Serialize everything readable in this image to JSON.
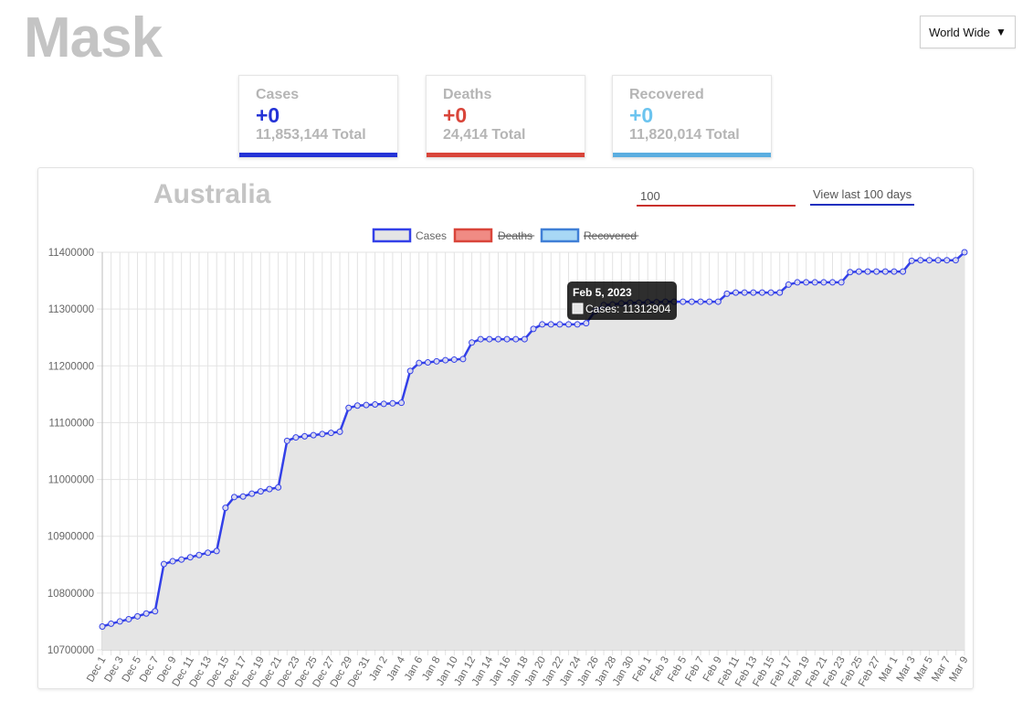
{
  "header": {
    "app_title": "Mask",
    "region_select": {
      "value": "World Wide",
      "arrow": "▼"
    }
  },
  "stats": {
    "cases": {
      "label": "Cases",
      "delta": "+0",
      "total": "11,853,144 Total",
      "color": "#2433d6"
    },
    "deaths": {
      "label": "Deaths",
      "delta": "+0",
      "total": "24,414 Total",
      "color": "#d9453a"
    },
    "recovered": {
      "label": "Recovered",
      "delta": "+0",
      "total": "11,820,014 Total",
      "color": "#6cc4ef"
    }
  },
  "panel": {
    "country": "Australia",
    "days_input_value": "100",
    "view_button": "View last 100 days"
  },
  "colors": {
    "cases_line": "#3340e8",
    "area_fill": "#e5e5e5",
    "deaths_bar": "#d9453a",
    "recovered_bar": "#5aaee0",
    "grid": "#e3e3e3"
  },
  "chart_data": {
    "type": "area",
    "title": "",
    "legend": [
      {
        "name": "Cases",
        "visible": true,
        "border": "#3340e8",
        "fill": "#e5e5e5"
      },
      {
        "name": "Deaths",
        "visible": false,
        "border": "#d9453a",
        "fill": "#f08b84"
      },
      {
        "name": "Recovered",
        "visible": false,
        "border": "#3f7fd6",
        "fill": "#a8d8f5"
      }
    ],
    "legend_position": "top",
    "ylim": [
      10700000,
      11400000
    ],
    "yticks": [
      10700000,
      10800000,
      10900000,
      11000000,
      11100000,
      11200000,
      11300000,
      11400000
    ],
    "x": [
      "Dec 1",
      "Dec 2",
      "Dec 3",
      "Dec 4",
      "Dec 5",
      "Dec 6",
      "Dec 7",
      "Dec 8",
      "Dec 9",
      "Dec 10",
      "Dec 11",
      "Dec 12",
      "Dec 13",
      "Dec 14",
      "Dec 15",
      "Dec 16",
      "Dec 17",
      "Dec 18",
      "Dec 19",
      "Dec 20",
      "Dec 21",
      "Dec 22",
      "Dec 23",
      "Dec 24",
      "Dec 25",
      "Dec 26",
      "Dec 27",
      "Dec 28",
      "Dec 29",
      "Dec 30",
      "Dec 31",
      "Jan 1",
      "Jan 2",
      "Jan 3",
      "Jan 4",
      "Jan 5",
      "Jan 6",
      "Jan 7",
      "Jan 8",
      "Jan 9",
      "Jan 10",
      "Jan 11",
      "Jan 12",
      "Jan 13",
      "Jan 14",
      "Jan 15",
      "Jan 16",
      "Jan 17",
      "Jan 18",
      "Jan 19",
      "Jan 20",
      "Jan 21",
      "Jan 22",
      "Jan 23",
      "Jan 24",
      "Jan 25",
      "Jan 26",
      "Jan 27",
      "Jan 28",
      "Jan 29",
      "Jan 30",
      "Jan 31",
      "Feb 1",
      "Feb 2",
      "Feb 3",
      "Feb 4",
      "Feb 5",
      "Feb 6",
      "Feb 7",
      "Feb 8",
      "Feb 9",
      "Feb 10",
      "Feb 11",
      "Feb 12",
      "Feb 13",
      "Feb 14",
      "Feb 15",
      "Feb 16",
      "Feb 17",
      "Feb 18",
      "Feb 19",
      "Feb 20",
      "Feb 21",
      "Feb 22",
      "Feb 23",
      "Feb 24",
      "Feb 25",
      "Feb 26",
      "Feb 27",
      "Feb 28",
      "Mar 1",
      "Mar 2",
      "Mar 3",
      "Mar 4",
      "Mar 5",
      "Mar 6",
      "Mar 7",
      "Mar 8",
      "Mar 9"
    ],
    "xtick_labels": [
      "Dec 1",
      "Dec 3",
      "Dec 5",
      "Dec 7",
      "Dec 9",
      "Dec 11",
      "Dec 13",
      "Dec 15",
      "Dec 17",
      "Dec 19",
      "Dec 21",
      "Dec 23",
      "Dec 25",
      "Dec 27",
      "Dec 29",
      "Dec 31",
      "Jan 2",
      "Jan 4",
      "Jan 6",
      "Jan 8",
      "Jan 10",
      "Jan 12",
      "Jan 14",
      "Jan 16",
      "Jan 18",
      "Jan 20",
      "Jan 22",
      "Jan 24",
      "Jan 26",
      "Jan 28",
      "Jan 30",
      "Feb 1",
      "Feb 3",
      "Feb 5",
      "Feb 7",
      "Feb 9",
      "Feb 11",
      "Feb 13",
      "Feb 15",
      "Feb 17",
      "Feb 19",
      "Feb 21",
      "Feb 23",
      "Feb 25",
      "Feb 27",
      "Mar 1",
      "Mar 3",
      "Mar 5",
      "Mar 7",
      "Mar 9"
    ],
    "series": [
      {
        "name": "Cases",
        "values": [
          10741000,
          10746000,
          10750000,
          10754000,
          10759000,
          10764000,
          10768000,
          10851000,
          10856000,
          10859000,
          10863000,
          10867000,
          10871000,
          10874000,
          10950000,
          10969000,
          10970000,
          10975000,
          10979000,
          10983000,
          10986000,
          11068000,
          11074000,
          11076000,
          11078000,
          11080000,
          11082000,
          11084000,
          11126000,
          11130000,
          11131000,
          11132000,
          11133000,
          11134000,
          11135000,
          11191000,
          11205000,
          11206000,
          11208000,
          11210000,
          11211000,
          11212000,
          11241000,
          11247000,
          11247000,
          11247000,
          11247000,
          11247000,
          11247000,
          11265000,
          11273000,
          11273000,
          11273000,
          11273000,
          11273000,
          11275000,
          11296000,
          11307000,
          11308000,
          11310000,
          11311000,
          11311000,
          11312000,
          11312000,
          11312904,
          11312904,
          11312904,
          11312904,
          11313000,
          11313000,
          11313000,
          11327000,
          11329000,
          11329000,
          11329000,
          11329000,
          11329000,
          11329000,
          11343000,
          11347000,
          11347000,
          11347000,
          11347000,
          11347000,
          11347000,
          11365000,
          11366000,
          11366000,
          11366000,
          11366000,
          11366000,
          11366000,
          11385000,
          11386000,
          11386000,
          11386000,
          11386000,
          11386000,
          11400000
        ]
      }
    ],
    "tooltip": {
      "title": "Feb 5, 2023",
      "text": "Cases: 11312904"
    }
  }
}
